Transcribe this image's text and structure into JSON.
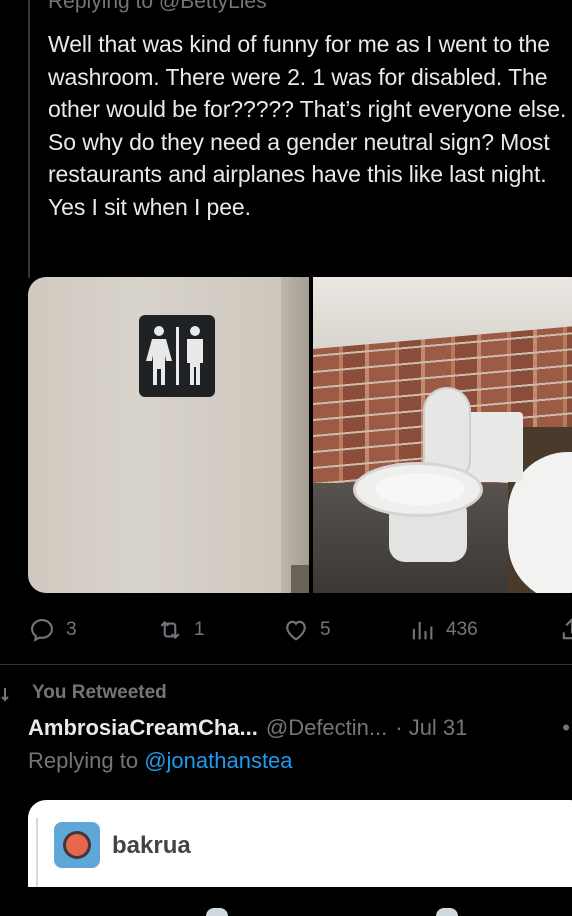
{
  "tweet": {
    "replying_to_top": "Replying to @BettyLies",
    "text": "Well that was kind of funny for me as I went to the washroom. There were 2. 1 was for disabled. The other would be for????? That’s right everyone else. So why do they need a gender neutral sign? Most restaurants and airplanes have this like last night.\nYes I sit when I pee."
  },
  "actions": {
    "replies": "3",
    "retweets": "1",
    "likes": "5",
    "views": "436"
  },
  "retweet_banner": "You Retweeted",
  "next_tweet": {
    "author_name": "AmbrosiaCreamCha...",
    "author_handle": "@Defectin...",
    "date": "· Jul 31",
    "more": "•",
    "replying_prefix": "Replying to",
    "replying_mention": "@jonathanstea"
  },
  "embed": {
    "username": "bakrua"
  },
  "colors": {
    "background": "#000000",
    "text": "#e7e9ea",
    "muted": "#71767b",
    "accent": "#1d9bf0"
  }
}
